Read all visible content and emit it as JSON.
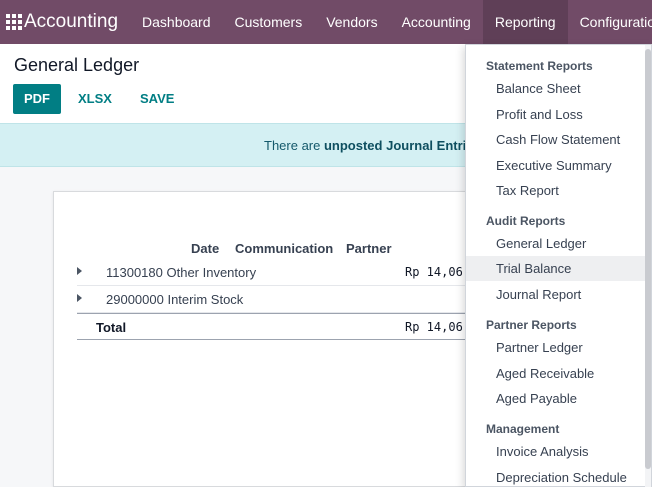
{
  "navbar": {
    "app_title": "Accounting",
    "menus": [
      "Dashboard",
      "Customers",
      "Vendors",
      "Accounting",
      "Reporting",
      "Configuration"
    ],
    "active_menu": "Reporting",
    "color": "#714b67"
  },
  "page": {
    "title": "General Ledger",
    "buttons": {
      "pdf": "PDF",
      "xlsx": "XLSX",
      "save": "SAVE"
    }
  },
  "alert": {
    "prefix": "There are ",
    "emphasis": "unposted Journal Entries"
  },
  "report": {
    "columns": [
      "Date",
      "Communication",
      "Partner"
    ],
    "rows": [
      {
        "account": "11300180 Other Inventory",
        "amount": "Rp 14,06"
      },
      {
        "account": "29000000 Interim Stock",
        "amount": ""
      }
    ],
    "total": {
      "label": "Total",
      "amount": "Rp 14,06"
    }
  },
  "dropdown": {
    "sections": [
      {
        "header": "Statement Reports",
        "items": [
          "Balance Sheet",
          "Profit and Loss",
          "Cash Flow Statement",
          "Executive Summary",
          "Tax Report"
        ]
      },
      {
        "header": "Audit Reports",
        "items": [
          "General Ledger",
          "Trial Balance",
          "Journal Report"
        ]
      },
      {
        "header": "Partner Reports",
        "items": [
          "Partner Ledger",
          "Aged Receivable",
          "Aged Payable"
        ]
      },
      {
        "header": "Management",
        "items": [
          "Invoice Analysis",
          "Depreciation Schedule"
        ]
      }
    ],
    "hovered_item": "Trial Balance"
  }
}
